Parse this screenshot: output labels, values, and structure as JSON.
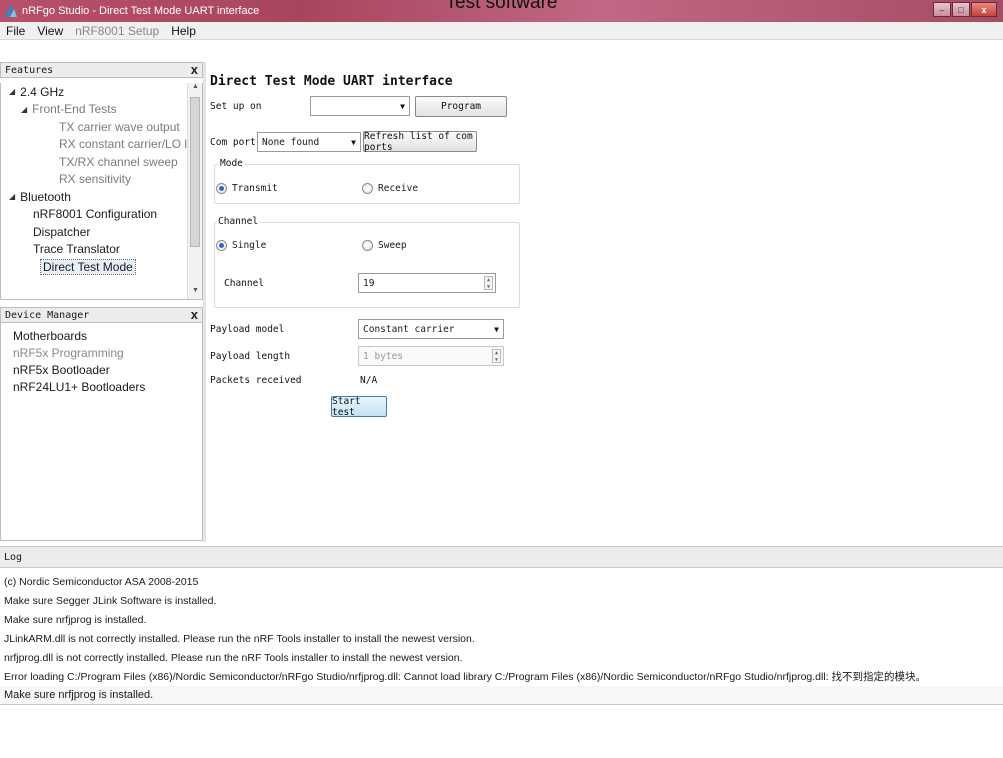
{
  "caption": "Test software",
  "window": {
    "title": "nRFgo Studio  - Direct Test Mode UART interface",
    "min": "–",
    "max": "□",
    "close": "x"
  },
  "menu": [
    "File",
    "View",
    "nRF8001 Setup",
    "Help"
  ],
  "features": {
    "title": "Features",
    "close": "x",
    "items": [
      {
        "label": "2.4 GHz",
        "arrow": "◢"
      },
      {
        "label": "Front-End Tests",
        "arrow": "◢"
      },
      {
        "label": "TX carrier wave output"
      },
      {
        "label": "RX constant carrier/LO leak..."
      },
      {
        "label": "TX/RX channel sweep"
      },
      {
        "label": "RX sensitivity"
      },
      {
        "label": "Bluetooth",
        "arrow": "◢"
      },
      {
        "label": "nRF8001 Configuration"
      },
      {
        "label": "Dispatcher"
      },
      {
        "label": "Trace Translator"
      },
      {
        "label": "Direct Test Mode"
      }
    ]
  },
  "device_manager": {
    "title": "Device Manager",
    "close": "x",
    "items": [
      "Motherboards",
      "nRF5x Programming",
      "nRF5x Bootloader",
      "nRF24LU1+ Bootloaders"
    ]
  },
  "dtm": {
    "title": "Direct Test Mode UART interface",
    "setup_label": "Set up on",
    "setup_value": "",
    "program_button": "Program",
    "com_label": "Com port",
    "com_value": "None found",
    "refresh_button": "Refresh list of com ports",
    "mode": {
      "title": "Mode",
      "transmit": "Transmit",
      "receive": "Receive"
    },
    "channel": {
      "title": "Channel",
      "single": "Single",
      "sweep": "Sweep",
      "channel_label": "Channel",
      "channel_value": "19"
    },
    "payload_model_label": "Payload model",
    "payload_model_value": "Constant carrier",
    "payload_length_label": "Payload length",
    "payload_length_value": "1 bytes",
    "packets_label": "Packets received",
    "packets_value": "N/A",
    "start_button": "Start test"
  },
  "log": {
    "title": "Log",
    "lines": [
      "(c) Nordic Semiconductor ASA 2008-2015",
      "Make sure Segger JLink Software is installed.",
      "Make sure nrfjprog is installed.",
      "JLinkARM.dll is not correctly installed. Please run the nRF Tools installer to install the newest version.",
      "nrfjprog.dll is not correctly installed. Please run the nRF Tools installer to install the newest version.",
      "Error loading C:/Program Files (x86)/Nordic Semiconductor/nRFgo Studio/nrfjprog.dll: Cannot load library C:/Program Files (x86)/Nordic Semiconductor/nRFgo Studio/nrfjprog.dll: 找不到指定的模块。",
      "Make sure nrfjprog is installed."
    ]
  }
}
